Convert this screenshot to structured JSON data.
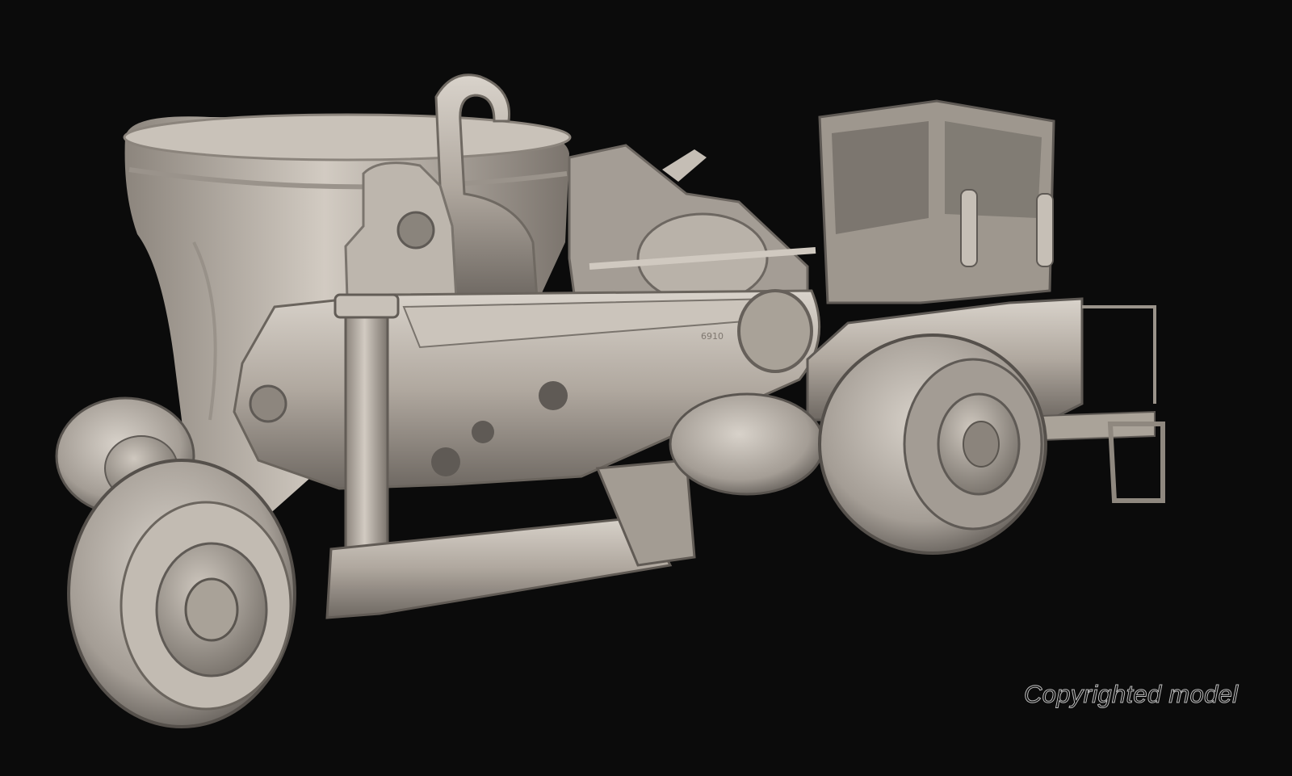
{
  "render": {
    "subject": "ladle transporter 3D model",
    "material_color": "#b3aca4",
    "background_color": "#0b0b0b"
  },
  "badge_text": "6910",
  "watermark": {
    "text": "Copyrighted model"
  }
}
